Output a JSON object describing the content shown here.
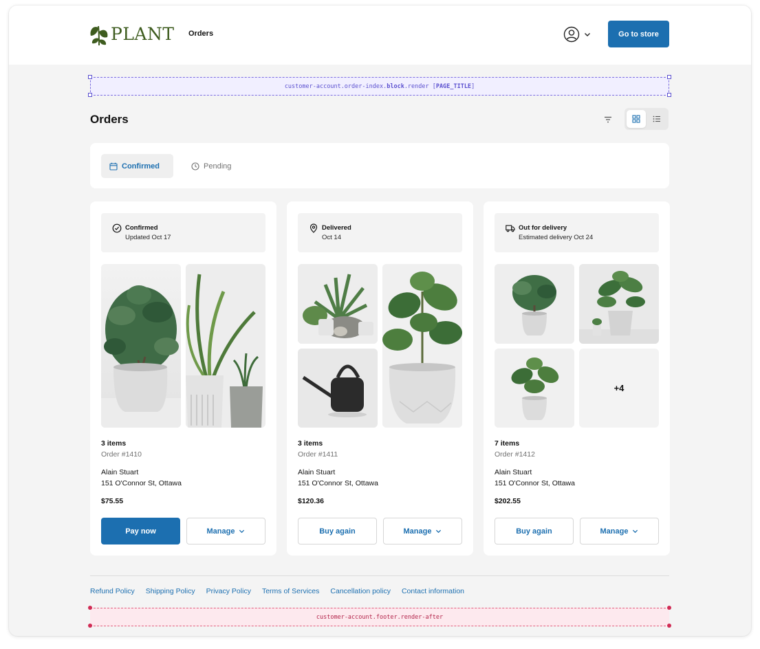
{
  "header": {
    "brand": "PLANT",
    "nav_orders": "Orders",
    "go_to_store": "Go to store"
  },
  "extension_points": {
    "top_prefix": "customer-account.order-index.",
    "top_bold": "block",
    "top_mid": ".render [",
    "top_target": "PAGE_TITLE",
    "top_suffix": "]",
    "bottom": "customer-account.footer.render-after"
  },
  "page": {
    "title": "Orders",
    "view_mode": "grid"
  },
  "tabs": [
    {
      "label": "Confirmed",
      "active": true,
      "icon": "calendar-icon"
    },
    {
      "label": "Pending",
      "active": false,
      "icon": "clock-icon"
    }
  ],
  "orders": [
    {
      "status": "Confirmed",
      "status_detail": "Updated Oct 17",
      "status_icon": "check-circle-icon",
      "items": "3 items",
      "order_number": "Order #1410",
      "customer": "Alain Stuart",
      "address": "151 O'Connor St, Ottawa",
      "total": "$75.55",
      "primary_action": "Pay now",
      "secondary_action": "Manage"
    },
    {
      "status": "Delivered",
      "status_detail": "Oct 14",
      "status_icon": "location-pin-icon",
      "items": "3 items",
      "order_number": "Order #1411",
      "customer": "Alain Stuart",
      "address": "151 O'Connor St, Ottawa",
      "total": "$120.36",
      "primary_action": "Buy again",
      "secondary_action": "Manage"
    },
    {
      "status": "Out for delivery",
      "status_detail": "Estimated delivery Oct 24",
      "status_icon": "truck-icon",
      "items": "7 items",
      "order_number": "Order #1412",
      "customer": "Alain Stuart",
      "address": "151 O'Connor St, Ottawa",
      "total": "$202.55",
      "primary_action": "Buy again",
      "secondary_action": "Manage",
      "more_count": "+4"
    }
  ],
  "footer": {
    "links": [
      "Refund Policy",
      "Shipping Policy",
      "Privacy Policy",
      "Terms of Services",
      "Cancellation policy",
      "Contact information"
    ]
  },
  "colors": {
    "accent": "#1c6fb0",
    "brand_green": "#3e5c1f",
    "background": "#f4f4f4"
  }
}
